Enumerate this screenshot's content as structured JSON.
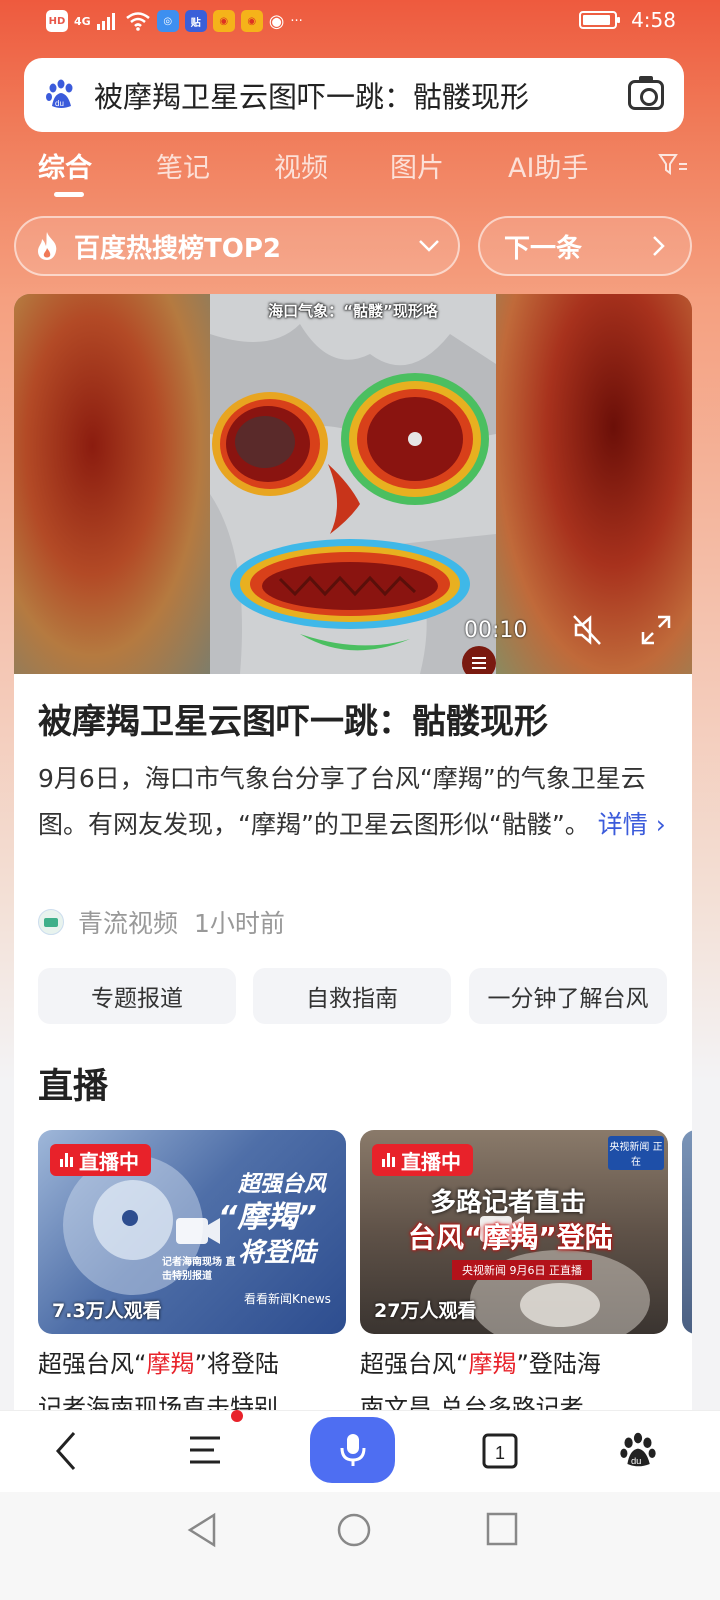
{
  "status_bar": {
    "left_icons": [
      "HD",
      "4G",
      "signal-icon",
      "wifi-icon",
      "app-icon",
      "tieba-icon",
      "weibo-icon",
      "weibo-icon",
      "weibo-icon"
    ],
    "more": "···",
    "time": "4:58"
  },
  "search": {
    "query": "被摩羯卫星云图吓一跳：骷髅现形"
  },
  "tabs": [
    {
      "label": "综合",
      "active": true
    },
    {
      "label": "笔记"
    },
    {
      "label": "视频"
    },
    {
      "label": "图片"
    },
    {
      "label": "AI助手"
    }
  ],
  "hot": {
    "label": "百度热搜榜TOP2",
    "next_label": "下一条"
  },
  "video": {
    "caption": "海口气象：“骷髅”现形咯",
    "time": "00:10"
  },
  "result": {
    "title": "被摩羯卫星云图吓一跳：骷髅现形",
    "description": "9月6日，海口市气象台分享了台风“摩羯”的气象卫星云图。有网友发现，“摩羯”的卫星云图形似“骷髅”。",
    "detail_link": "详情",
    "source": "青流视频",
    "time": "1小时前",
    "chips": [
      "专题报道",
      "自救指南",
      "一分钟了解台风"
    ]
  },
  "live": {
    "heading": "直播",
    "items": [
      {
        "badge": "直播中",
        "viewers": "7.3万人观看",
        "overlay_title_1": "超强台风",
        "overlay_title_2": "“摩羯”",
        "overlay_title_3": "将登陆",
        "overlay_sub": "记者海南现场 直击特别报道",
        "overlay_brand": "看看新闻Knews",
        "title_pre": "超强台风“",
        "title_hl": "摩羯",
        "title_post": "”将登陆",
        "title_line2": "记者海南现场直击特别"
      },
      {
        "badge": "直播中",
        "viewers": "27万人观看",
        "overlay_title_1": "多路记者直击",
        "overlay_title_2": "台风“摩羯”登陆",
        "overlay_sub": "央视新闻 9月6日 正直播",
        "overlay_brand": "央视新闻 正在",
        "title_pre": "超强台风“",
        "title_hl": "摩羯",
        "title_post": "”登陆海",
        "title_line2": "南文昌 总台多路记者"
      }
    ]
  },
  "colors": {
    "accent": "#ee5a3e",
    "link": "#3b5bdb",
    "live_red": "#e8222a",
    "mic_blue": "#4e6ef2"
  }
}
